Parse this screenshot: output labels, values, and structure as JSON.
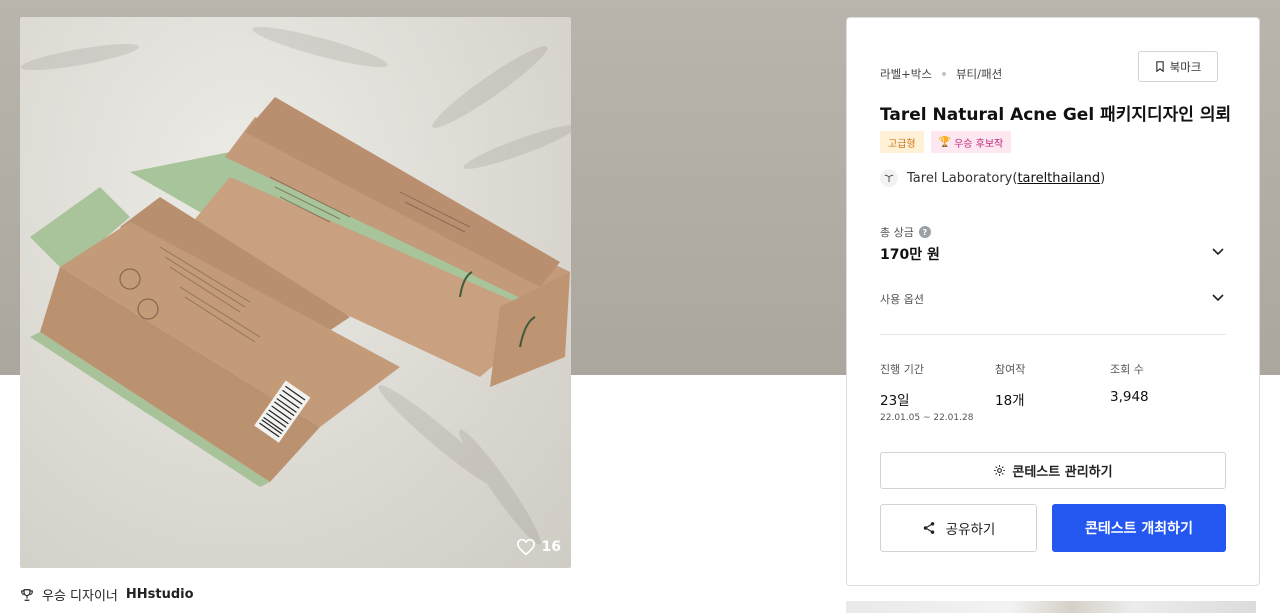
{
  "product": {
    "like_count": "16",
    "winner_prefix": "우승 디자이너",
    "winner_name": "HHstudio"
  },
  "contest": {
    "category_primary": "라벨+박스",
    "category_secondary": "뷰티/패션",
    "bookmark_label": "북마크",
    "title": "Tarel Natural Acne Gel 패키지디자인 의뢰",
    "badge_premium": "고급형",
    "badge_candidate": "우승 후보작",
    "host_name": "Tarel Laboratory",
    "host_paren_open": "(",
    "host_handle": "tarelthailand",
    "host_paren_close": ")",
    "prize_label": "총 상금",
    "prize_value": "170만 원",
    "options_label": "사용 옵션",
    "stats": {
      "period_label": "진행 기간",
      "period_value": "23일",
      "period_range": "22.01.05 ~ 22.01.28",
      "entries_label": "참여작",
      "entries_value": "18개",
      "views_label": "조회 수",
      "views_value": "3,948"
    },
    "manage_label": "콘테스트 관리하기",
    "share_label": "공유하기",
    "host_contest_label": "콘테스트 개최하기"
  },
  "colors": {
    "primary_button": "#2457f0",
    "premium_badge_bg": "#fff1d6",
    "premium_badge_text": "#c9791b",
    "candidate_badge_bg": "#fde7f1",
    "candidate_badge_text": "#c2267a",
    "hero_background": "#b3afa7"
  }
}
